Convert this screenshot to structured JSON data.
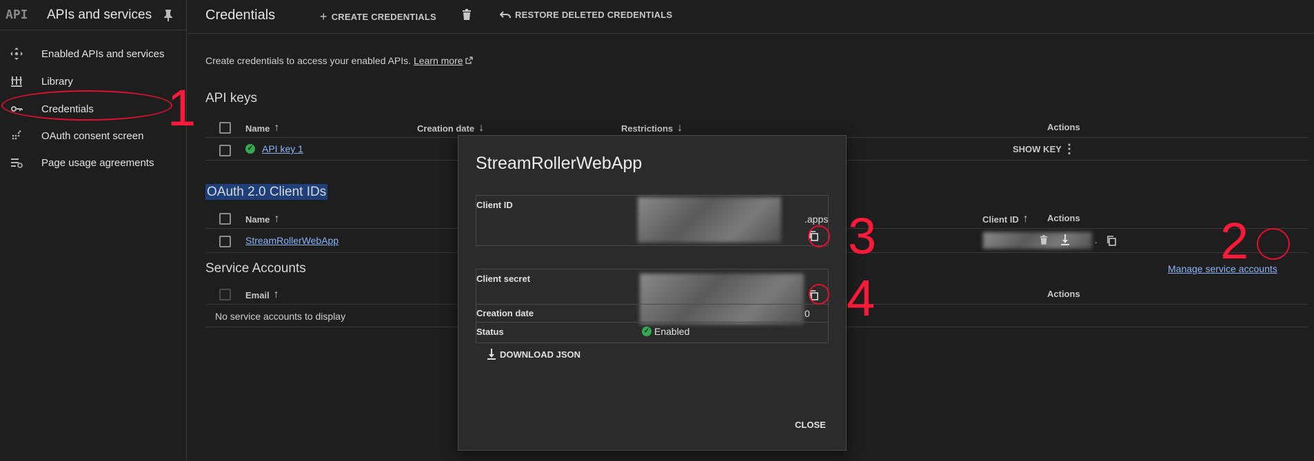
{
  "sidebar": {
    "logo": "API",
    "title": "APIs and services",
    "items": [
      {
        "label": "Enabled APIs and services",
        "icon": "enabled-apis-icon"
      },
      {
        "label": "Library",
        "icon": "library-icon"
      },
      {
        "label": "Credentials",
        "icon": "key-icon"
      },
      {
        "label": "OAuth consent screen",
        "icon": "oauth-consent-icon"
      },
      {
        "label": "Page usage agreements",
        "icon": "page-usage-icon"
      }
    ]
  },
  "topbar": {
    "title": "Credentials",
    "create_label": "CREATE CREDENTIALS",
    "restore_label": "RESTORE DELETED CREDENTIALS"
  },
  "main": {
    "intro_text": "Create credentials to access your enabled APIs.",
    "learn_more": "Learn more",
    "api_keys": {
      "title": "API keys",
      "headers": {
        "name": "Name",
        "creation_date": "Creation date",
        "restrictions": "Restrictions",
        "actions": "Actions"
      },
      "rows": [
        {
          "name": "API key 1",
          "action": "SHOW KEY"
        }
      ]
    },
    "oauth": {
      "title": "OAuth 2.0 Client IDs",
      "headers": {
        "name": "Name",
        "client_id": "Client ID",
        "actions": "Actions"
      },
      "rows": [
        {
          "name": "StreamRollerWebApp",
          "client_id_suffix": "."
        }
      ]
    },
    "service_accounts": {
      "title": "Service Accounts",
      "manage_link": "Manage service accounts",
      "headers": {
        "email": "Email",
        "actions": "Actions"
      },
      "empty_text": "No service accounts to display"
    }
  },
  "dialog": {
    "title": "StreamRollerWebApp",
    "client_id_label": "Client ID",
    "client_id_suffix": ".apps",
    "client_secret_label": "Client secret",
    "creation_date_label": "Creation date",
    "creation_date_suffix": "0",
    "status_label": "Status",
    "status_value": "Enabled",
    "download_label": "DOWNLOAD JSON",
    "close_label": "CLOSE"
  },
  "annotations": {
    "n1": "1",
    "n2": "2",
    "n3": "3",
    "n4": "4"
  },
  "colors": {
    "accent_link": "#8ab4f8",
    "annotation": "#ff1a3a",
    "success": "#34a853",
    "highlight": "#1e3f7a"
  }
}
